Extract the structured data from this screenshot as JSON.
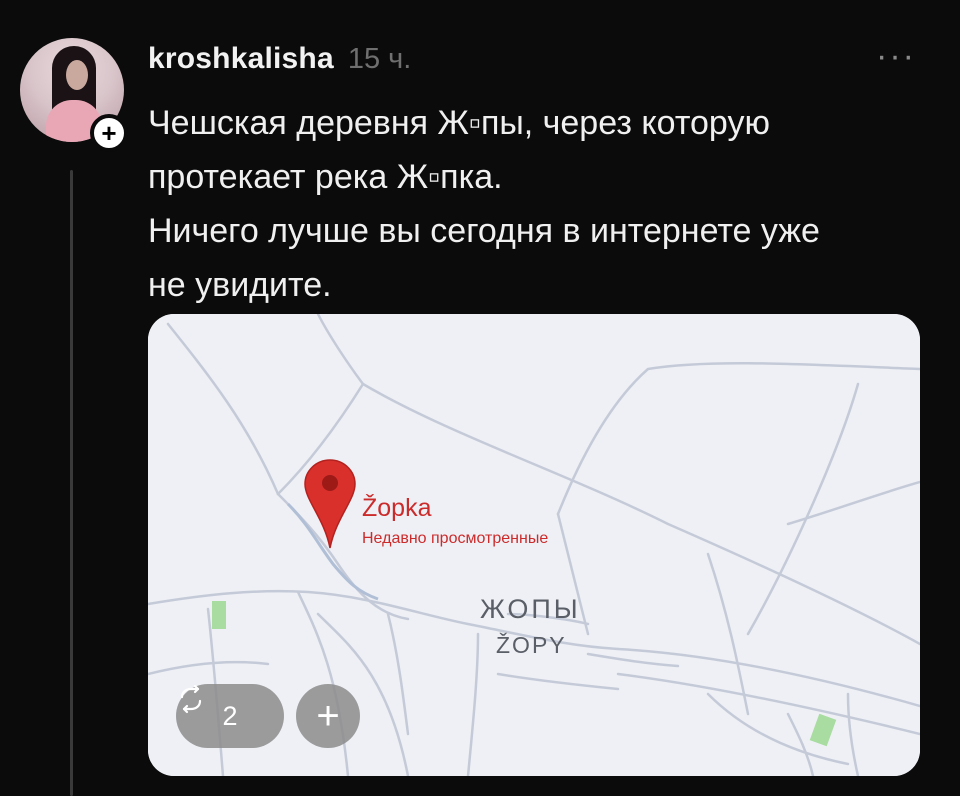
{
  "post": {
    "username": "kroshkalisha",
    "time": "15 ч.",
    "more_icon": "more-dots-icon",
    "text_lines": [
      "Чешская деревня Ж▫пы, через которую\nпротекает река Ж▫пка.",
      "Ничего лучше вы сегодня в интернете уже\nне увидите."
    ],
    "follow_icon": "plus-icon",
    "follow_label": "+"
  },
  "media": {
    "place_name": "Žopka",
    "place_subtitle": "Недавно просмотренные",
    "village_name_ru": "ЖОПЫ",
    "village_name_cz": "ŽOPY",
    "pin_icon": "map-pin-icon",
    "repost_count": "2",
    "repost_icon": "repost-icon",
    "add_label": "+",
    "pin_color": "#d9302c",
    "park_color": "#a8dca0"
  }
}
